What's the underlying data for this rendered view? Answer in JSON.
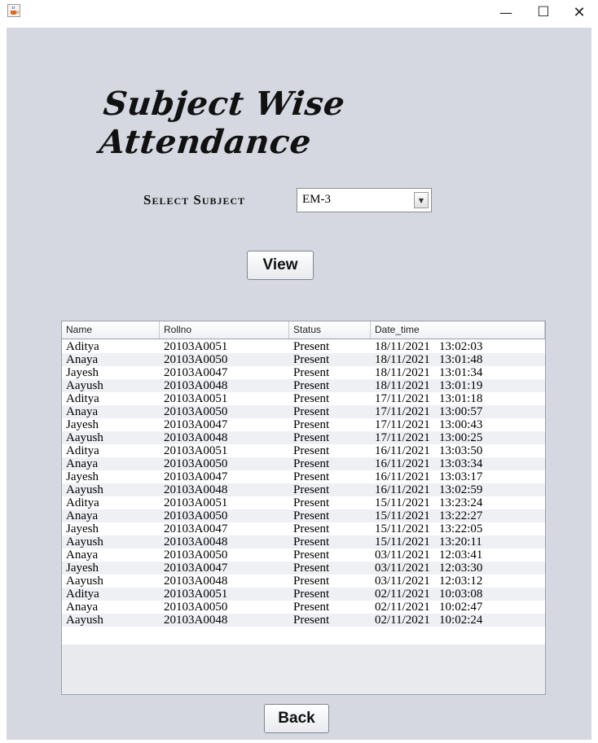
{
  "window": {
    "minimize_glyph": "—",
    "maximize_glyph": "☐",
    "close_glyph": "✕",
    "app_icon": "java-cup-icon"
  },
  "page": {
    "heading": "Subject Wise Attendance",
    "select_label": "Select Subject",
    "subject_selected": "EM-3",
    "view_label": "View",
    "back_label": "Back"
  },
  "table": {
    "columns": [
      "Name",
      "Rollno",
      "Status",
      "Date_time"
    ],
    "rows": [
      [
        "Aditya",
        "20103A0051",
        "Present",
        "18/11/2021   13:02:03"
      ],
      [
        "Anaya",
        "20103A0050",
        "Present",
        "18/11/2021   13:01:48"
      ],
      [
        "Jayesh",
        "20103A0047",
        "Present",
        "18/11/2021   13:01:34"
      ],
      [
        "Aayush",
        "20103A0048",
        "Present",
        "18/11/2021   13:01:19"
      ],
      [
        "Aditya",
        "20103A0051",
        "Present",
        "17/11/2021   13:01:18"
      ],
      [
        "Anaya",
        "20103A0050",
        "Present",
        "17/11/2021   13:00:57"
      ],
      [
        "Jayesh",
        "20103A0047",
        "Present",
        "17/11/2021   13:00:43"
      ],
      [
        "Aayush",
        "20103A0048",
        "Present",
        "17/11/2021   13:00:25"
      ],
      [
        "Aditya",
        "20103A0051",
        "Present",
        "16/11/2021   13:03:50"
      ],
      [
        "Anaya",
        "20103A0050",
        "Present",
        "16/11/2021   13:03:34"
      ],
      [
        "Jayesh",
        "20103A0047",
        "Present",
        "16/11/2021   13:03:17"
      ],
      [
        "Aayush",
        "20103A0048",
        "Present",
        "16/11/2021   13:02:59"
      ],
      [
        "Aditya",
        "20103A0051",
        "Present",
        "15/11/2021   13:23:24"
      ],
      [
        "Anaya",
        "20103A0050",
        "Present",
        "15/11/2021   13:22:27"
      ],
      [
        "Jayesh",
        "20103A0047",
        "Present",
        "15/11/2021   13:22:05"
      ],
      [
        "Aayush",
        "20103A0048",
        "Present",
        "15/11/2021   13:20:11"
      ],
      [
        "Anaya",
        "20103A0050",
        "Present",
        "03/11/2021   12:03:41"
      ],
      [
        "Jayesh",
        "20103A0047",
        "Present",
        "03/11/2021   12:03:30"
      ],
      [
        "Aayush",
        "20103A0048",
        "Present",
        "03/11/2021   12:03:12"
      ],
      [
        "Aditya",
        "20103A0051",
        "Present",
        "02/11/2021   10:03:08"
      ],
      [
        "Anaya",
        "20103A0050",
        "Present",
        "02/11/2021   10:02:47"
      ],
      [
        "Aayush",
        "20103A0048",
        "Present",
        "02/11/2021   10:02:24"
      ]
    ]
  }
}
